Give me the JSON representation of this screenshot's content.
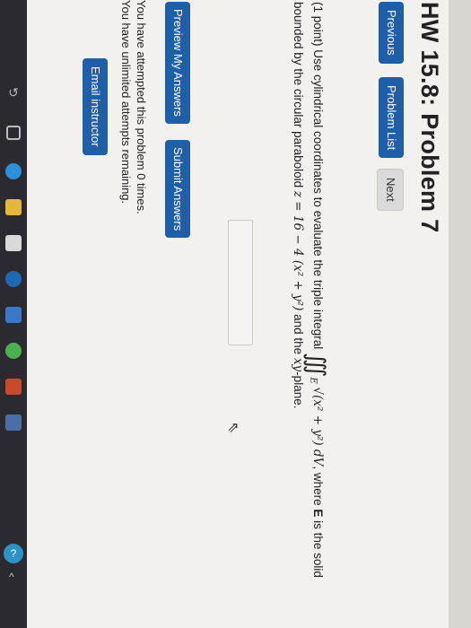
{
  "browser": {
    "url_fragment": "...10871"
  },
  "page": {
    "title": "HW 15.8: Problem 7",
    "nav": {
      "previous": "Previous",
      "problem_list": "Problem List",
      "next": "Next"
    },
    "question": {
      "line1_prefix": "(1 point) Use cylindrical coordinates to evaluate the triple integral",
      "integral": "∭",
      "region": "E",
      "integrand": "√(x² + y²) dV",
      "line1_suffix": ", where",
      "region_bold": "E",
      "line1_end": "is the solid",
      "line2_prefix": "bounded by the circular paraboloid",
      "equation": "z = 16 − 4 (x² + y²)",
      "line2_suffix": "and the",
      "plane": "xy",
      "line2_end": "-plane."
    },
    "answer_input": {
      "value": ""
    },
    "buttons": {
      "preview": "Preview My Answers",
      "submit": "Submit Answers"
    },
    "attempts": {
      "line1": "You have attempted this problem 0 times.",
      "line2": "You have unlimited attempts remaining."
    },
    "email": "Email instructor"
  },
  "taskbar": {
    "icons": [
      "back-icon",
      "task-view-icon",
      "edge-icon",
      "file-explorer-icon",
      "store-icon",
      "hp-icon",
      "media-icon",
      "chrome-icon",
      "powerpoint-icon",
      "reader-icon"
    ],
    "tray_help": "?",
    "tray_chevron": "^"
  }
}
